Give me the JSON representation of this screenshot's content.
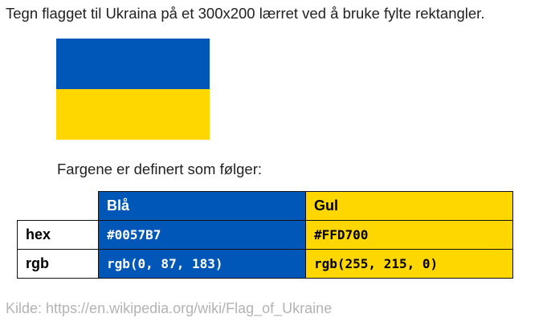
{
  "task_text": "Tegn flagget til Ukraina på et 300x200 lærret ved å bruke fylte rektangler.",
  "flag": {
    "top_color": "#0057B7",
    "bottom_color": "#FFD700"
  },
  "intro_text": "Fargene er definert som følger:",
  "color_table": {
    "columns": [
      "Blå",
      "Gul"
    ],
    "column_colors": [
      "#0057B7",
      "#FFD700"
    ],
    "column_text_colors": [
      "#FFFFFF",
      "#000000"
    ],
    "rows": [
      {
        "label": "hex",
        "values": [
          "#0057B7",
          "#FFD700"
        ]
      },
      {
        "label": "rgb",
        "values": [
          "rgb(0, 87, 183)",
          "rgb(255, 215, 0)"
        ]
      }
    ]
  },
  "source_text": "Kilde: https://en.wikipedia.org/wiki/Flag_of_Ukraine"
}
